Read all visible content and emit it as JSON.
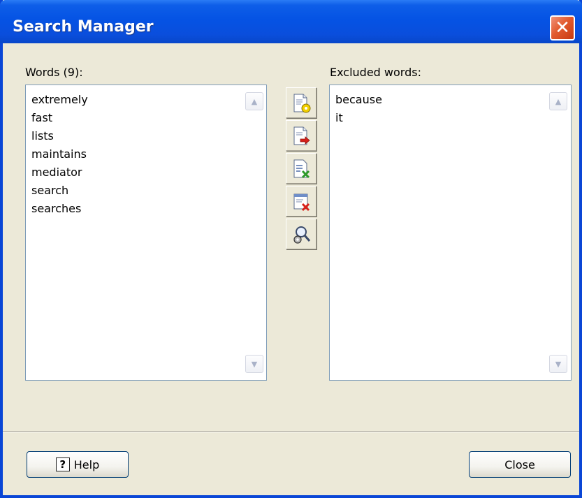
{
  "window": {
    "title": "Search Manager",
    "close_glyph": "✕"
  },
  "words": {
    "label": "Words (9):",
    "items": [
      "extremely",
      "fast",
      "lists",
      "maintains",
      "mediator",
      "search",
      "searches"
    ]
  },
  "excluded": {
    "label": "Excluded words:",
    "items": [
      "because",
      "it"
    ]
  },
  "toolbar": {
    "buttons": [
      {
        "icon": "document-settings-icon",
        "title": "settings"
      },
      {
        "icon": "document-move-right-icon",
        "title": "move"
      },
      {
        "icon": "document-list-delete-icon",
        "title": "delete"
      },
      {
        "icon": "window-close-red-icon",
        "title": "clear"
      },
      {
        "icon": "search-settings-icon",
        "title": "search"
      }
    ]
  },
  "footer": {
    "help_label": "Help",
    "help_icon_glyph": "?",
    "close_label": "Close"
  },
  "scroll": {
    "up_glyph": "▲",
    "down_glyph": "▼"
  },
  "colors": {
    "titlebar": "#0553e4",
    "frame": "#0a46d6",
    "dialog_bg": "#ece9d8",
    "list_border": "#7f9db9",
    "close_button": "#e25a2e"
  }
}
